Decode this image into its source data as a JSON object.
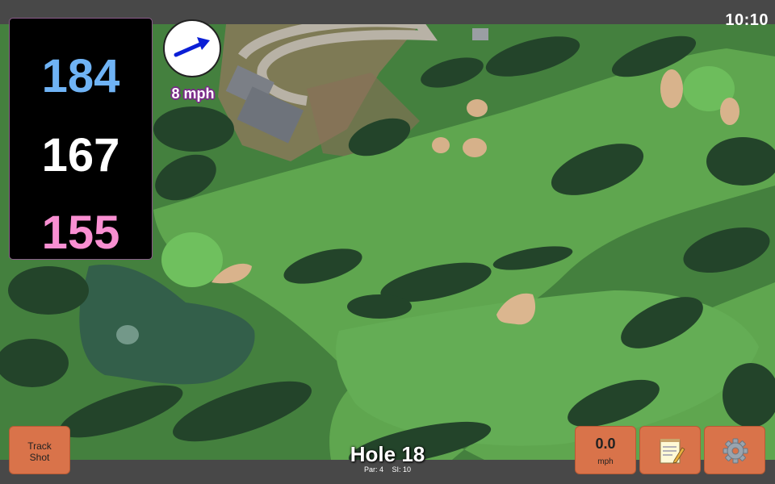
{
  "status_bar": {
    "time": "10:10"
  },
  "distances": {
    "back": "184",
    "center": "167",
    "front": "155"
  },
  "wind": {
    "speed_label": "8 mph",
    "direction_icon": "wind-arrow-icon"
  },
  "hole": {
    "title": "Hole 18",
    "par_label": "Par: 4",
    "si_label": "SI: 10"
  },
  "buttons": {
    "track_shot": "Track\nShot",
    "speed_value": "0.0",
    "speed_unit": "mph",
    "notes_icon": "notepad-icon",
    "settings_icon": "gear-icon"
  },
  "colors": {
    "back": "#6fb3f5",
    "center": "#ffffff",
    "front": "#f98fd2",
    "button": "#d9734a",
    "wind_outline": "#7a2a8a"
  }
}
